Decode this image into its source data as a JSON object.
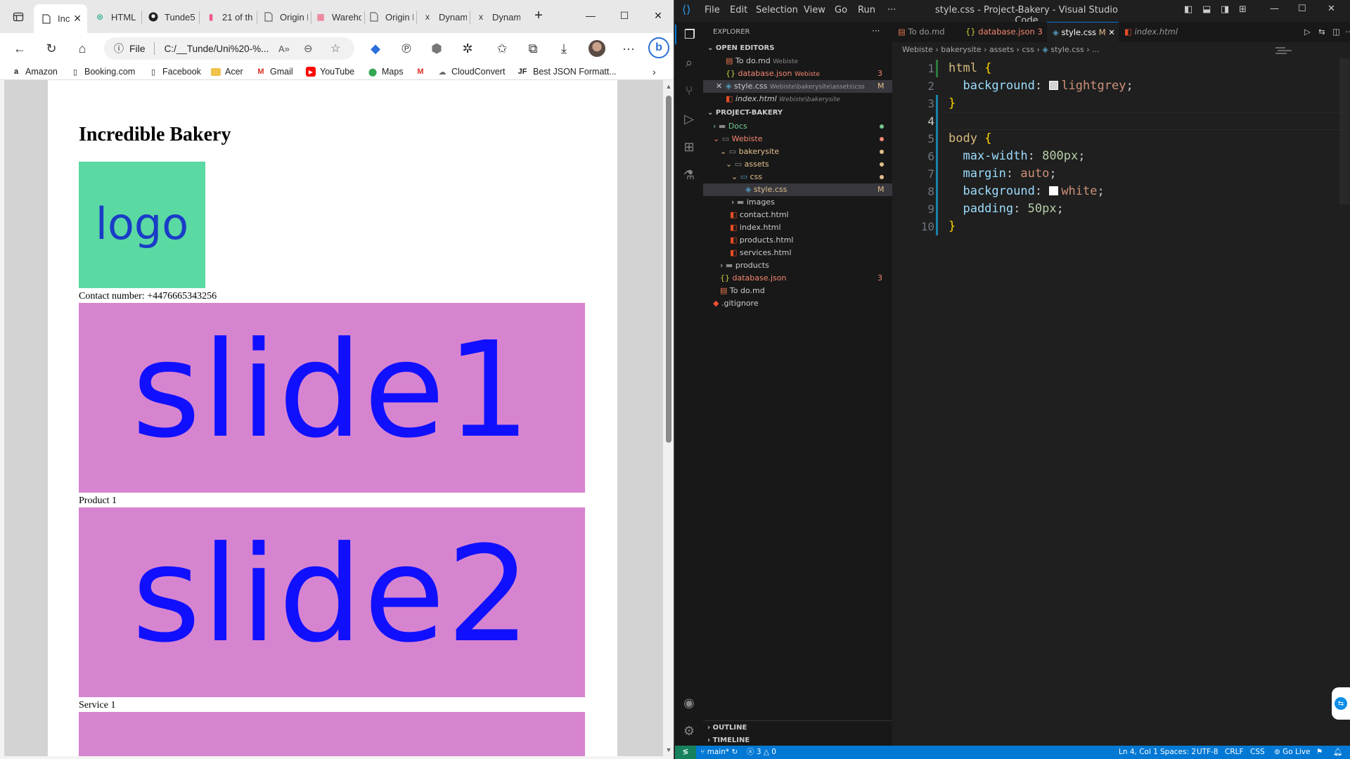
{
  "browser": {
    "tabs": [
      {
        "label": "Inc",
        "icon": "page-icon",
        "active": true
      },
      {
        "label": "HTML C",
        "icon": "chatgpt-icon"
      },
      {
        "label": "Tunde5",
        "icon": "github-icon"
      },
      {
        "label": "21 of th",
        "icon": "app-icon"
      },
      {
        "label": "Origin E",
        "icon": "page-icon"
      },
      {
        "label": "Wareho",
        "icon": "app-icon"
      },
      {
        "label": "Origin E",
        "icon": "page-icon"
      },
      {
        "label": "Dynam",
        "icon": "x-icon"
      },
      {
        "label": "Dynam",
        "icon": "x-icon"
      }
    ],
    "address": {
      "prefix": "File",
      "url": "C:/__Tunde/Uni%20-%..."
    },
    "bookmarks": [
      {
        "label": "Amazon",
        "icon": "amazon-icon"
      },
      {
        "label": "Booking.com",
        "icon": "page-icon"
      },
      {
        "label": "Facebook",
        "icon": "page-icon"
      },
      {
        "label": "Acer",
        "icon": "folder-icon"
      },
      {
        "label": "Gmail",
        "icon": "gmail-icon"
      },
      {
        "label": "YouTube",
        "icon": "youtube-icon"
      },
      {
        "label": "Maps",
        "icon": "maps-icon"
      },
      {
        "label": "",
        "icon": "gmail-icon"
      },
      {
        "label": "CloudConvert",
        "icon": "cloud-icon"
      },
      {
        "label": "Best JSON Formatt...",
        "icon": "jf-icon"
      }
    ],
    "page": {
      "heading": "Incredible Bakery",
      "logo_text": "logo",
      "contact": "Contact number: +4476665343256",
      "slides": [
        {
          "text": "slide1",
          "caption": "Product 1"
        },
        {
          "text": "slide2",
          "caption": "Service 1"
        },
        {
          "text": "",
          "caption": ""
        }
      ]
    },
    "colors": {
      "logo_bg": "#5bd9a3",
      "slide_bg": "#d784d0",
      "slide_text": "#1010ff"
    }
  },
  "vscode": {
    "title": "style.css - Project-Bakery - Visual Studio Code",
    "menu": [
      "File",
      "Edit",
      "Selection",
      "View",
      "Go",
      "Run",
      "···"
    ],
    "explorer": {
      "header": "EXPLORER",
      "open_editors_label": "OPEN EDITORS",
      "open_editors": [
        {
          "name": "To do.md",
          "path": "Webiste",
          "badge": ""
        },
        {
          "name": "database.json",
          "path": "Webiste",
          "badge": "3"
        },
        {
          "name": "style.css",
          "path": "Webiste\\bakerysite\\assets\\css",
          "badge": "M"
        },
        {
          "name": "index.html",
          "path": "Webiste\\bakerysite",
          "badge": ""
        }
      ],
      "project_label": "PROJECT-BAKERY",
      "tree": [
        {
          "name": "Docs",
          "badge": ""
        },
        {
          "name": "Webiste",
          "badge": ""
        },
        {
          "name": "bakerysite",
          "badge": ""
        },
        {
          "name": "assets",
          "badge": ""
        },
        {
          "name": "css",
          "badge": ""
        },
        {
          "name": "style.css",
          "badge": "M"
        },
        {
          "name": "images",
          "badge": ""
        },
        {
          "name": "contact.html",
          "badge": ""
        },
        {
          "name": "index.html",
          "badge": ""
        },
        {
          "name": "products.html",
          "badge": ""
        },
        {
          "name": "services.html",
          "badge": ""
        },
        {
          "name": "products",
          "badge": ""
        },
        {
          "name": "database.json",
          "badge": "3"
        },
        {
          "name": "To do.md",
          "badge": ""
        },
        {
          "name": ".gitignore",
          "badge": ""
        }
      ],
      "outline_label": "OUTLINE",
      "timeline_label": "TIMELINE"
    },
    "editor_tabs": [
      {
        "label": "To do.md",
        "badge": ""
      },
      {
        "label": "database.json",
        "badge": "3"
      },
      {
        "label": "style.css",
        "badge": "M"
      },
      {
        "label": "index.html",
        "badge": ""
      }
    ],
    "breadcrumbs": [
      "Webiste",
      "bakerysite",
      "assets",
      "css",
      "style.css",
      "..."
    ],
    "code": [
      {
        "n": "1",
        "t": "html {"
      },
      {
        "n": "2",
        "t": "  background: lightgrey;"
      },
      {
        "n": "3",
        "t": "}"
      },
      {
        "n": "4",
        "t": ""
      },
      {
        "n": "5",
        "t": "body {"
      },
      {
        "n": "6",
        "t": "  max-width: 800px;"
      },
      {
        "n": "7",
        "t": "  margin: auto;"
      },
      {
        "n": "8",
        "t": "  background: white;"
      },
      {
        "n": "9",
        "t": "  padding: 50px;"
      },
      {
        "n": "10",
        "t": "}"
      }
    ],
    "status": {
      "branch": "main*",
      "errors": "3",
      "warnings": "0",
      "position": "Ln 4, Col 1",
      "spaces": "Spaces: 2",
      "encoding": "UTF-8",
      "eol": "CRLF",
      "language": "CSS",
      "golive": "Go Live"
    }
  }
}
